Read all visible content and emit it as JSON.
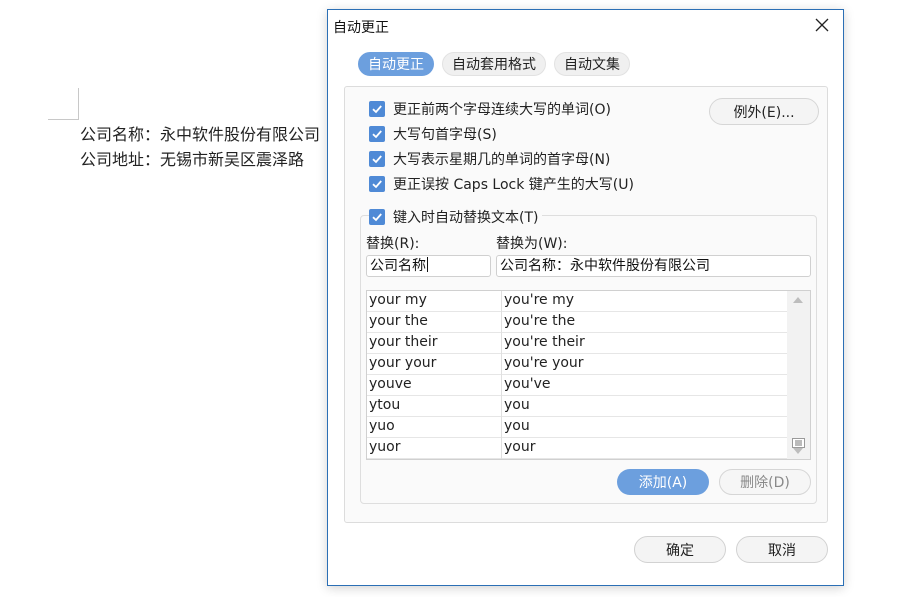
{
  "document": {
    "line1": "公司名称：永中软件股份有限公司",
    "line2": "公司地址：无锡市新吴区震泽路"
  },
  "dialog": {
    "title": "自动更正",
    "close_icon": "close-icon"
  },
  "tabs": [
    {
      "label": "自动更正",
      "active": true
    },
    {
      "label": "自动套用格式",
      "active": false
    },
    {
      "label": "自动文集",
      "active": false
    }
  ],
  "options": {
    "correct_two_initial_caps": "更正前两个字母连续大写的单词(O)",
    "capitalize_first_letter": "大写句首字母(S)",
    "capitalize_weekdays": "大写表示星期几的单词的首字母(N)",
    "correct_caps_lock": "更正误按 Caps Lock 键产生的大写(U)",
    "replace_as_you_type": "键入时自动替换文本(T)",
    "checked": true
  },
  "exceptions_button": "例外(E)...",
  "replace": {
    "label": "替换(R):",
    "value": "公司名称"
  },
  "with": {
    "label": "替换为(W):",
    "value": "公司名称：永中软件股份有限公司"
  },
  "entries": [
    {
      "replace": "your my",
      "with": "you're my"
    },
    {
      "replace": "your the",
      "with": "you're the"
    },
    {
      "replace": "your their",
      "with": "you're their"
    },
    {
      "replace": "your your",
      "with": "you're your"
    },
    {
      "replace": "youve",
      "with": "you've"
    },
    {
      "replace": "ytou",
      "with": "you"
    },
    {
      "replace": "yuo",
      "with": "you"
    },
    {
      "replace": "yuor",
      "with": "your"
    }
  ],
  "buttons": {
    "add": "添加(A)",
    "delete": "删除(D)",
    "ok": "确定",
    "cancel": "取消"
  },
  "colors": {
    "accent": "#6c9fde",
    "checkbox": "#4f8ad6",
    "dialog_border": "#2b6fb5"
  }
}
